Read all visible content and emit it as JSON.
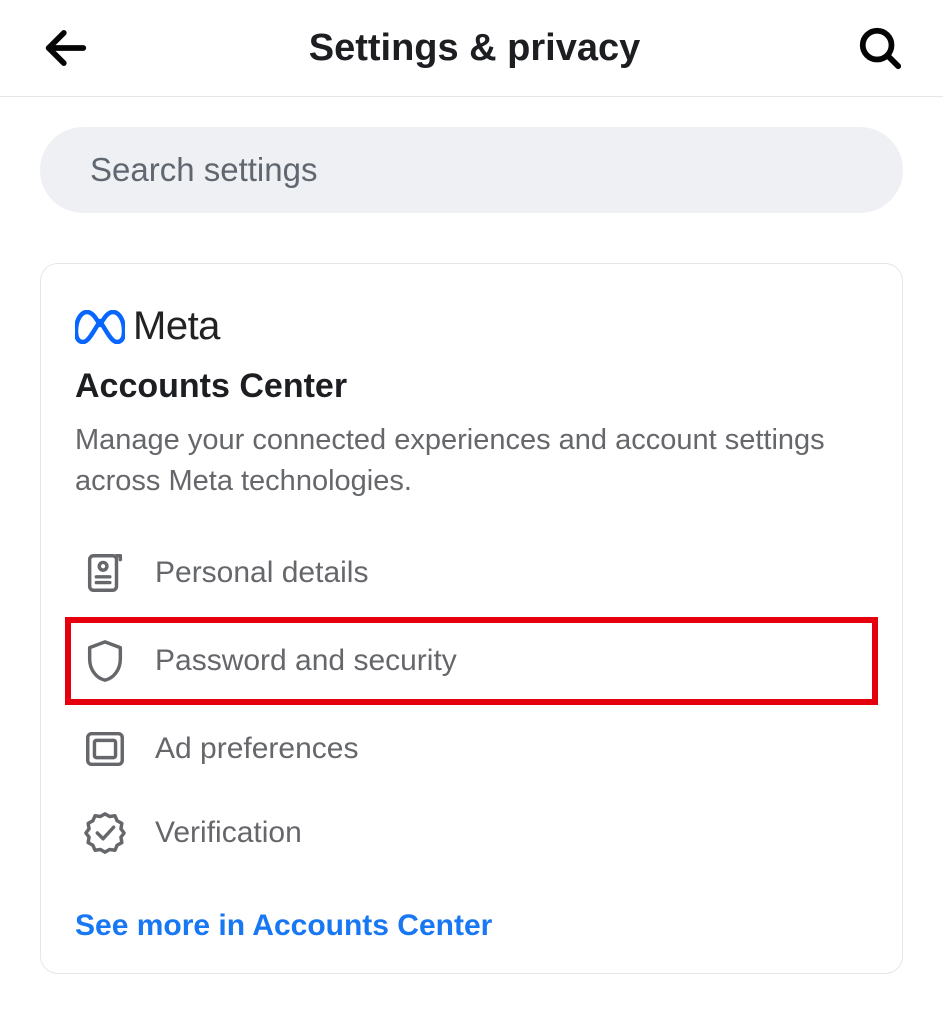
{
  "header": {
    "title": "Settings & privacy"
  },
  "search": {
    "placeholder": "Search settings"
  },
  "card": {
    "brand": "Meta",
    "title": "Accounts Center",
    "description": "Manage your connected experiences and account settings across Meta technologies.",
    "items": [
      {
        "label": "Personal details"
      },
      {
        "label": "Password and security"
      },
      {
        "label": "Ad preferences"
      },
      {
        "label": "Verification"
      }
    ],
    "see_more": "See more in Accounts Center"
  }
}
